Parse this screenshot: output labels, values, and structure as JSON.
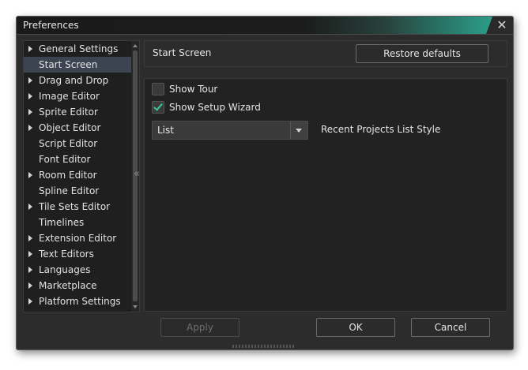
{
  "window": {
    "title": "Preferences",
    "close_glyph": "✕"
  },
  "sidebar": {
    "items": [
      {
        "label": "General Settings",
        "expandable": true,
        "selected": false
      },
      {
        "label": "Start Screen",
        "expandable": false,
        "selected": true
      },
      {
        "label": "Drag and Drop",
        "expandable": true,
        "selected": false
      },
      {
        "label": "Image Editor",
        "expandable": true,
        "selected": false
      },
      {
        "label": "Sprite Editor",
        "expandable": true,
        "selected": false
      },
      {
        "label": "Object Editor",
        "expandable": true,
        "selected": false
      },
      {
        "label": "Script Editor",
        "expandable": false,
        "selected": false
      },
      {
        "label": "Font Editor",
        "expandable": false,
        "selected": false
      },
      {
        "label": "Room Editor",
        "expandable": true,
        "selected": false
      },
      {
        "label": "Spline Editor",
        "expandable": false,
        "selected": false
      },
      {
        "label": "Tile Sets Editor",
        "expandable": true,
        "selected": false
      },
      {
        "label": "Timelines",
        "expandable": false,
        "selected": false
      },
      {
        "label": "Extension Editor",
        "expandable": true,
        "selected": false
      },
      {
        "label": "Text Editors",
        "expandable": true,
        "selected": false
      },
      {
        "label": "Languages",
        "expandable": true,
        "selected": false
      },
      {
        "label": "Marketplace",
        "expandable": true,
        "selected": false
      },
      {
        "label": "Platform Settings",
        "expandable": true,
        "selected": false
      }
    ],
    "collapse_glyph": "«"
  },
  "panel": {
    "title": "Start Screen",
    "restore_label": "Restore defaults"
  },
  "options": {
    "show_tour": {
      "label": "Show Tour",
      "checked": false
    },
    "show_setup_wizard": {
      "label": "Show Setup Wizard",
      "checked": true
    },
    "list_style": {
      "value": "List",
      "label": "Recent Projects List Style"
    }
  },
  "footer": {
    "apply_label": "Apply",
    "ok_label": "OK",
    "cancel_label": "Cancel"
  },
  "colors": {
    "accent": "#3fc59b",
    "selection": "#3c4451",
    "titlebar_glow": "#33a890"
  }
}
